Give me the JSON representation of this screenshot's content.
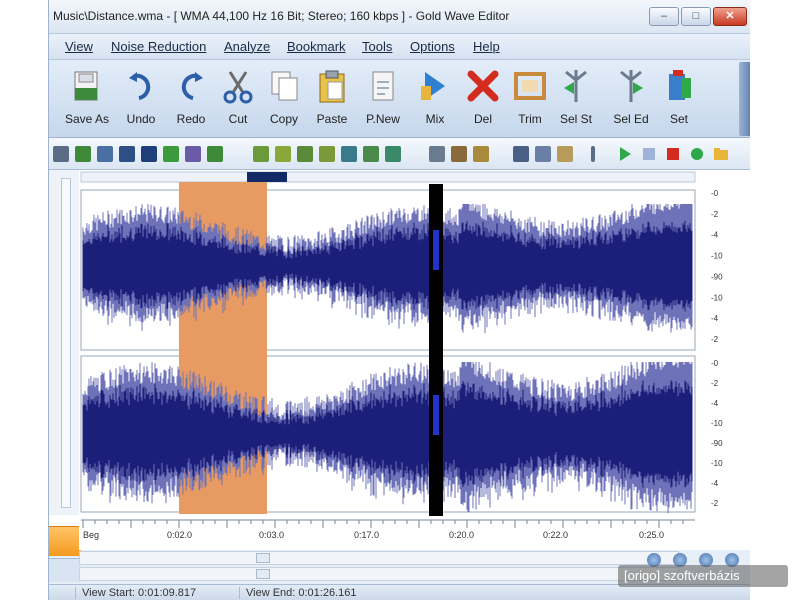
{
  "window": {
    "title": "Music\\Distance.wma - [ WMA 44,100 Hz 16 Bit; Stereo; 160 kbps ] - Gold Wave Editor",
    "buttons": {
      "minimize": "–",
      "maximize": "□",
      "close": "✕"
    }
  },
  "menu": {
    "items": [
      "View",
      "Noise Reduction",
      "Analyze",
      "Bookmark",
      "Tools",
      "Options",
      "Help"
    ]
  },
  "toolbar": {
    "items": [
      {
        "label": "Save As",
        "icon": "save-as-icon"
      },
      {
        "label": "Undo",
        "icon": "undo-icon"
      },
      {
        "label": "Redo",
        "icon": "redo-icon"
      },
      {
        "label": "Cut",
        "icon": "cut-icon"
      },
      {
        "label": "Copy",
        "icon": "copy-icon"
      },
      {
        "label": "Paste",
        "icon": "paste-icon"
      },
      {
        "label": "P.New",
        "icon": "paste-new-icon"
      },
      {
        "label": "Mix",
        "icon": "mix-icon"
      },
      {
        "label": "Del",
        "icon": "delete-icon"
      },
      {
        "label": "Trim",
        "icon": "trim-icon"
      },
      {
        "label": "Sel St",
        "icon": "select-start-icon"
      },
      {
        "label": "Sel Ed",
        "icon": "select-end-icon"
      },
      {
        "label": "Set",
        "icon": "set-icon"
      }
    ]
  },
  "colors": {
    "waveform": "#1c1f7a",
    "waveform_light": "#6e72b8",
    "selection": "#e79a62",
    "marker": "#000000",
    "accent": "#3a63a8"
  },
  "timeline": {
    "ticks": [
      "0:02.0",
      "0:03.0",
      "0:17.0",
      "0:20.0",
      "0:22.0",
      "0:25.0"
    ],
    "start_label": "Beg"
  },
  "db_scale": {
    "top": [
      "-0",
      "-2",
      "-4",
      "-10",
      "-90",
      "-10",
      "-4",
      "-2"
    ],
    "bottom": [
      "-0",
      "-2",
      "-4",
      "-10",
      "-90",
      "-10",
      "-4",
      "-2"
    ]
  },
  "status": {
    "view_start": "View Start: 0:01:09.817",
    "view_end": "View End: 0:01:26.161"
  },
  "watermark": {
    "text": "[origo] szoftverbázis"
  }
}
